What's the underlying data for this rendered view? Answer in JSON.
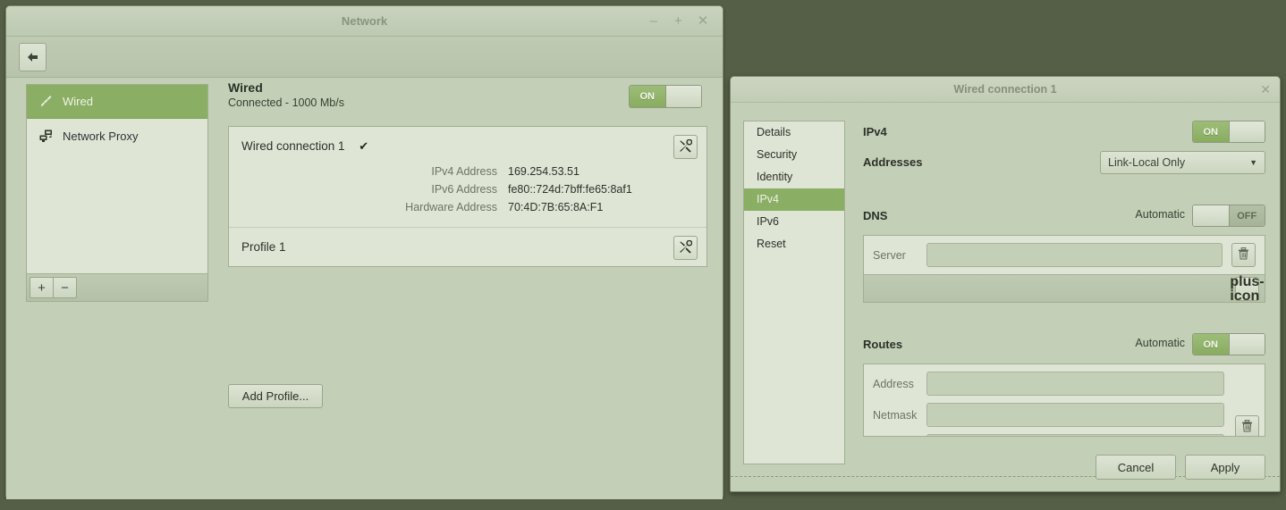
{
  "window": {
    "title": "Network",
    "controls": {
      "minimize": "–",
      "maximize": "+",
      "close": "✕"
    },
    "back_icon": "back-arrow-icon"
  },
  "sidebar": {
    "items": [
      {
        "label": "Wired",
        "icon": "network-wired-icon",
        "selected": true
      },
      {
        "label": "Network Proxy",
        "icon": "network-proxy-icon",
        "selected": false
      }
    ],
    "footer": {
      "add": "+",
      "remove": "−"
    }
  },
  "main": {
    "heading": "Wired",
    "subheading": "Connected - 1000 Mb/s",
    "power_toggle": {
      "state": "ON",
      "on_label": "ON"
    },
    "connection": {
      "name": "Wired connection 1",
      "active_check": "✔",
      "settings_icon": "tools-icon",
      "details": [
        {
          "key": "IPv4 Address",
          "value": "169.254.53.51"
        },
        {
          "key": "IPv6 Address",
          "value": "fe80::724d:7bff:fe65:8af1"
        },
        {
          "key": "Hardware Address",
          "value": "70:4D:7B:65:8A:F1"
        }
      ]
    },
    "profile": {
      "name": "Profile 1",
      "settings_icon": "tools-icon"
    },
    "add_profile_label": "Add Profile..."
  },
  "dialog": {
    "title": "Wired connection 1",
    "close": "✕",
    "nav": [
      {
        "label": "Details",
        "selected": false
      },
      {
        "label": "Security",
        "selected": false
      },
      {
        "label": "Identity",
        "selected": false
      },
      {
        "label": "IPv4",
        "selected": true
      },
      {
        "label": "IPv6",
        "selected": false
      },
      {
        "label": "Reset",
        "selected": false
      }
    ],
    "ipv4": {
      "label": "IPv4",
      "toggle": "ON"
    },
    "addresses": {
      "label": "Addresses",
      "selected_option": "Link-Local Only",
      "arrow": "▼"
    },
    "dns": {
      "label": "DNS",
      "automatic_label": "Automatic",
      "toggle": "OFF",
      "server_label": "Server",
      "server_value": "",
      "delete_icon": "trash-icon",
      "add_icon": "plus-icon"
    },
    "routes": {
      "label": "Routes",
      "automatic_label": "Automatic",
      "toggle": "ON",
      "address_label": "Address",
      "address_value": "",
      "netmask_label": "Netmask",
      "netmask_value": "",
      "delete_icon": "trash-icon"
    },
    "buttons": {
      "cancel": "Cancel",
      "apply": "Apply"
    }
  }
}
